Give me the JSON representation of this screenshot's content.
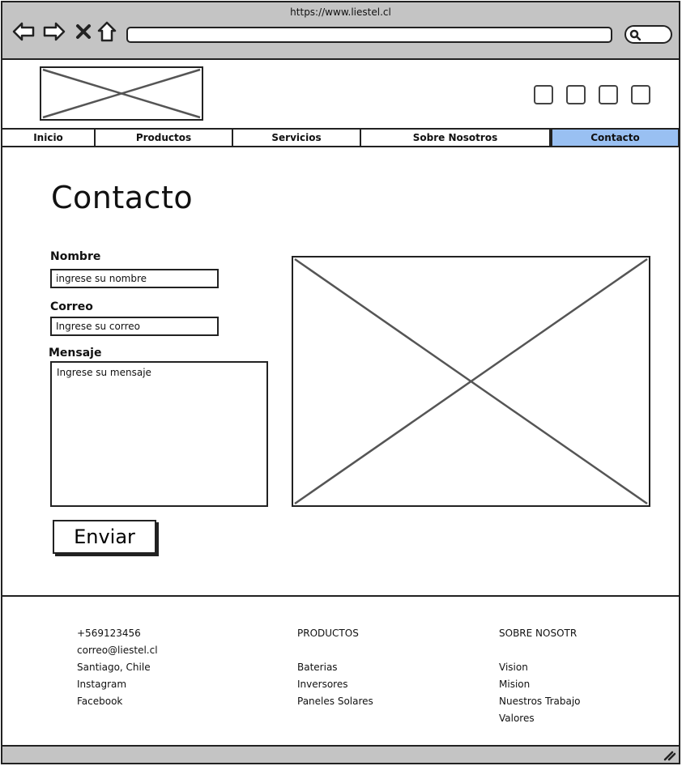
{
  "browser": {
    "url": "https://www.liestel.cl",
    "icons": [
      "back-arrow-icon",
      "forward-arrow-icon",
      "close-icon",
      "home-icon",
      "search-icon"
    ]
  },
  "nav": {
    "tabs": [
      {
        "label": "Inicio"
      },
      {
        "label": "Productos"
      },
      {
        "label": "Servicios"
      },
      {
        "label": "Sobre Nosotros"
      },
      {
        "label": "Contacto"
      }
    ],
    "active": "Contacto",
    "active_color": "#99c0f2"
  },
  "main": {
    "title": "Contacto",
    "form": {
      "name_label": "Nombre",
      "name_placeholder": "ingrese su nombre",
      "email_label": "Correo",
      "email_placeholder": "Ingrese su correo",
      "message_label": "Mensaje",
      "message_placeholder": "Ingrese su mensaje",
      "submit_label": "Enviar"
    }
  },
  "footer": {
    "contact": [
      "+569123456",
      "correo@liestel.cl",
      "Santiago, Chile",
      "Instagram",
      "Facebook"
    ],
    "products_heading": "PRODUCTOS",
    "products": [
      "Baterias",
      "Inversores",
      "Paneles Solares"
    ],
    "about_heading": "SOBRE NOSOTR",
    "about": [
      "Vision",
      "Mision",
      "Nuestros Trabajo",
      "Valores"
    ]
  }
}
